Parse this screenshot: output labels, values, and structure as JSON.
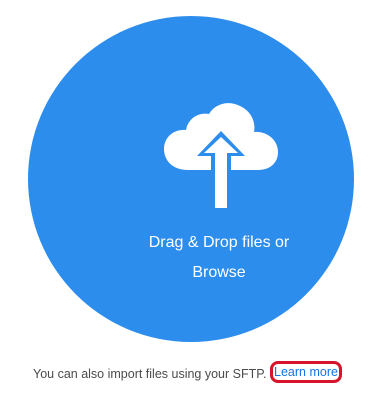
{
  "dropzone": {
    "line1": "Drag & Drop files or",
    "line2": "Browse",
    "icon": "cloud-upload-icon",
    "bg_color": "#2d8ded"
  },
  "footer": {
    "text": "You can also import files using your SFTP.",
    "link_label": "Learn more",
    "link_color": "#1473e6",
    "highlight_color": "#d6152a"
  }
}
